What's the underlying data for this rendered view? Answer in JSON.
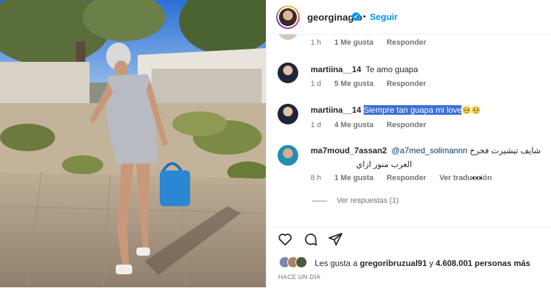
{
  "post": {
    "author": "georginagio",
    "follow_label": "Seguir",
    "separator": "•",
    "verified_mark": "✓"
  },
  "comments": {
    "top_meta": {
      "time": "1 h",
      "likes": "1 Me gusta",
      "reply": "Responder"
    },
    "items": [
      {
        "user": "martiina__14",
        "text": "Te amo guapa",
        "time": "1 d",
        "likes": "5 Me gusta",
        "reply": "Responder"
      },
      {
        "user": "martiina__14",
        "text": "Siempre tan guapa mi love",
        "emojis": "🥺🥺",
        "time": "1 d",
        "likes": "4 Me gusta",
        "reply": "Responder"
      },
      {
        "user": "ma7moud_7assan2",
        "mention": "@a7med_solimannn",
        "text_line1": "شايف تيشيرت فخرخ",
        "text_line2": "العرب منور ازاي",
        "time": "8 h",
        "likes": "1 Me gusta",
        "reply": "Responder",
        "translate": "Ver traducción",
        "more": "•••"
      }
    ],
    "view_replies": "Ver respuestas (1)"
  },
  "actions": {
    "icons": [
      "heart-icon",
      "comment-icon",
      "share-icon"
    ],
    "likes_prefix": "Les gusta a",
    "likes_user": "gregoribruzual91",
    "likes_suffix": "y",
    "likes_count": "4.608.001 personas más",
    "posted_ago": "HACE UN DÍA"
  },
  "colors": {
    "accent": "#0095f6",
    "highlight": "#3b6fd8",
    "text": "#262626",
    "muted": "#737373"
  }
}
